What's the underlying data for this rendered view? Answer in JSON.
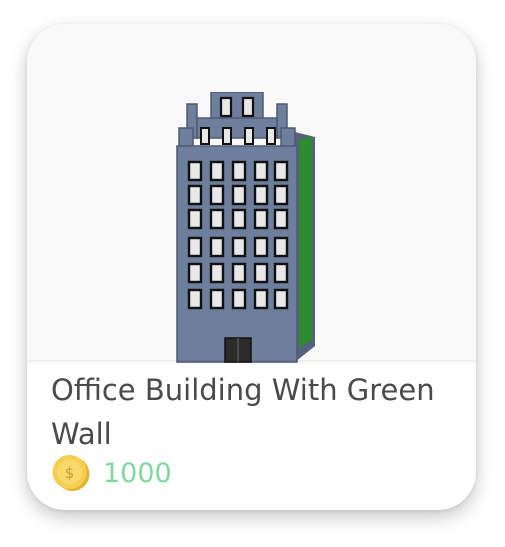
{
  "item": {
    "title": "Office Building With Green Wall",
    "price": "1000",
    "image_icon": "office-building",
    "currency_icon": "coin"
  },
  "colors": {
    "price_text": "#7ed9a0",
    "title_text": "#4a4a4a",
    "building_body": "#6e7f9e",
    "green_wall": "#2e8b2e",
    "coin": "#f3cf4d"
  }
}
